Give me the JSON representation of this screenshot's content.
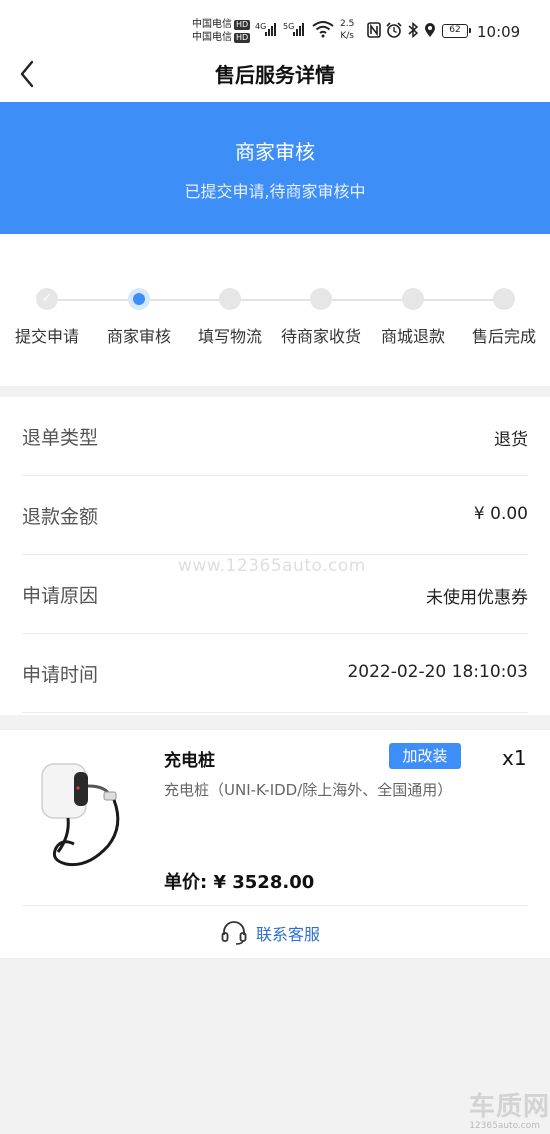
{
  "status_bar": {
    "carrier_1": "中国电信",
    "carrier_2": "中国电信",
    "hd_1": "HD",
    "hd_2": "HD",
    "net_1": "4G",
    "net_2": "5G",
    "speed_value": "2.5",
    "speed_unit": "K/s",
    "battery": "62",
    "time": "10:09",
    "icons": [
      "nfc-icon",
      "alarm-icon",
      "bluetooth-icon",
      "location-icon",
      "wifi-icon"
    ]
  },
  "nav": {
    "title": "售后服务详情",
    "back_icon": "chevron-left-icon"
  },
  "banner": {
    "title": "商家审核",
    "subtitle": "已提交申请,待商家审核中",
    "color": "#3e8ef7"
  },
  "steps": {
    "items": [
      {
        "label": "提交申请",
        "state": "done"
      },
      {
        "label": "商家审核",
        "state": "current"
      },
      {
        "label": "填写物流",
        "state": "pending"
      },
      {
        "label": "待商家收货",
        "state": "pending"
      },
      {
        "label": "商城退款",
        "state": "pending"
      },
      {
        "label": "售后完成",
        "state": "pending"
      }
    ]
  },
  "info": {
    "rows": [
      {
        "key": "退单类型",
        "value": "退货"
      },
      {
        "key": "退款金额",
        "value": "¥ 0.00"
      },
      {
        "key": "申请原因",
        "value": "未使用优惠券"
      },
      {
        "key": "申请时间",
        "value": "2022-02-20 18:10:03"
      }
    ]
  },
  "watermark": "www.12365auto.com",
  "product": {
    "name": "充电桩",
    "tag": "加改装",
    "quantity": "x1",
    "description": "充电桩（UNI-K-IDD/除上海外、全国通用）",
    "price_label": "单价: ¥ 3528.00",
    "image_icon": "charging-pile-image"
  },
  "contact": {
    "label": "联系客服",
    "icon": "headset-icon",
    "color": "#2f6fd0"
  },
  "footer_logo": {
    "big": "车质网",
    "small": "12365auto.com"
  }
}
